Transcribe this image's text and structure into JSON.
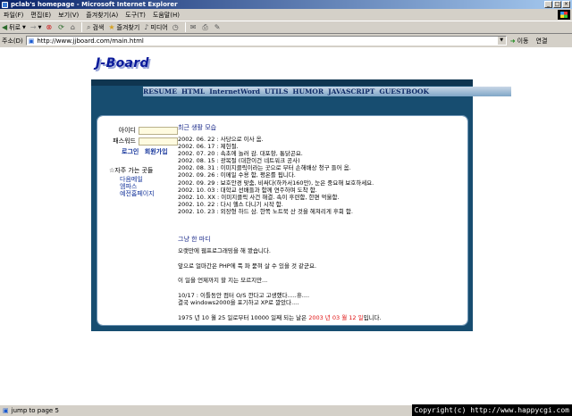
{
  "window": {
    "title": "pclab's homepage - Microsoft Internet Explorer"
  },
  "menubar": [
    "파일(F)",
    "편집(E)",
    "보기(V)",
    "즐겨찾기(A)",
    "도구(T)",
    "도움말(H)"
  ],
  "toolbar": {
    "back": "뒤로",
    "search": "검색",
    "favorites": "즐겨찾기",
    "media": "미디어"
  },
  "address": {
    "label": "주소(D)",
    "url": "http://www.jjboard.com/main.html",
    "go": "이동",
    "links": "연결"
  },
  "logo": "J-Board",
  "nav": [
    "RESUME",
    "HTML",
    "InternetWord",
    "UTILS",
    "HUMOR",
    "JAVASCRIPT",
    "GUESTBOOK"
  ],
  "login": {
    "id_label": "아이디",
    "pw_label": "패스워드",
    "login": "로그인",
    "join": "회원가입"
  },
  "favorites": {
    "title": "☆자주 가는 곳들",
    "items": [
      "다음메일",
      "엠파스",
      "예전홈페이지"
    ]
  },
  "recent": {
    "title": "최근 생활 모습",
    "lines": [
      "2002. 06. 22 : 사당으로 이사 옴.",
      "2002. 06. 17 : 제헌절.",
      "2002. 07. 20 : 속초에 놀러 감. 대포항, 통닭곤요.",
      "2002. 08. 15 : 광복절 (대한이건 네트워크 공사)",
      "2002. 08. 31 : 이미지클릭이라는 곳으로 부터 손해배상 청구 들어 옴.",
      "2002. 09. 26 : 이메일 수용 함, 평온를 됩니다.",
      "2002. 09. 29 : 보호안경 맞춤, 비싸다(하카서160만), 눈은 중요해 보호하세요.",
      "2002. 10. 03 : 대학교 선배들과 함께 연주하며 도착 함.",
      "2002. 10. XX : 이미지클릭 사건 해결. 속이 후련함, 한편 억울함.",
      "2002. 10. 22 : 다시 헬스 다니기 시작 함.",
      "2002. 10. 23 : 외장형 하드 삼. 한쪽 노트북 산 것을 헤쳐리게 후회 함."
    ]
  },
  "diary": {
    "title": "그냥 한 마디",
    "p1": "오랫만에 웹프로그래밍을 해 봤습니다.",
    "p2": "앞으로 얼마간은 PHP에 푹 파 묻혀 살 수 있을 것 같군요.",
    "p3": "이 일을 언제까지 할 지는 모르지만...",
    "p4a": "10/17 : 이틀동안 컴터 O/S 깐다고 고생했다.....휴....",
    "p4b": "결국 windows2000을 포기하고 XP로 깔았다....",
    "count_prefix": "1975 년 10 월 25 일로부터 10000 일째 되는 날은",
    "count_date": "2003 년 03 월 12 일",
    "count_suffix": "입니다."
  },
  "status": {
    "text": "jump to page 5",
    "copyright": "Copyright(c) http://www.happycgi.com"
  }
}
